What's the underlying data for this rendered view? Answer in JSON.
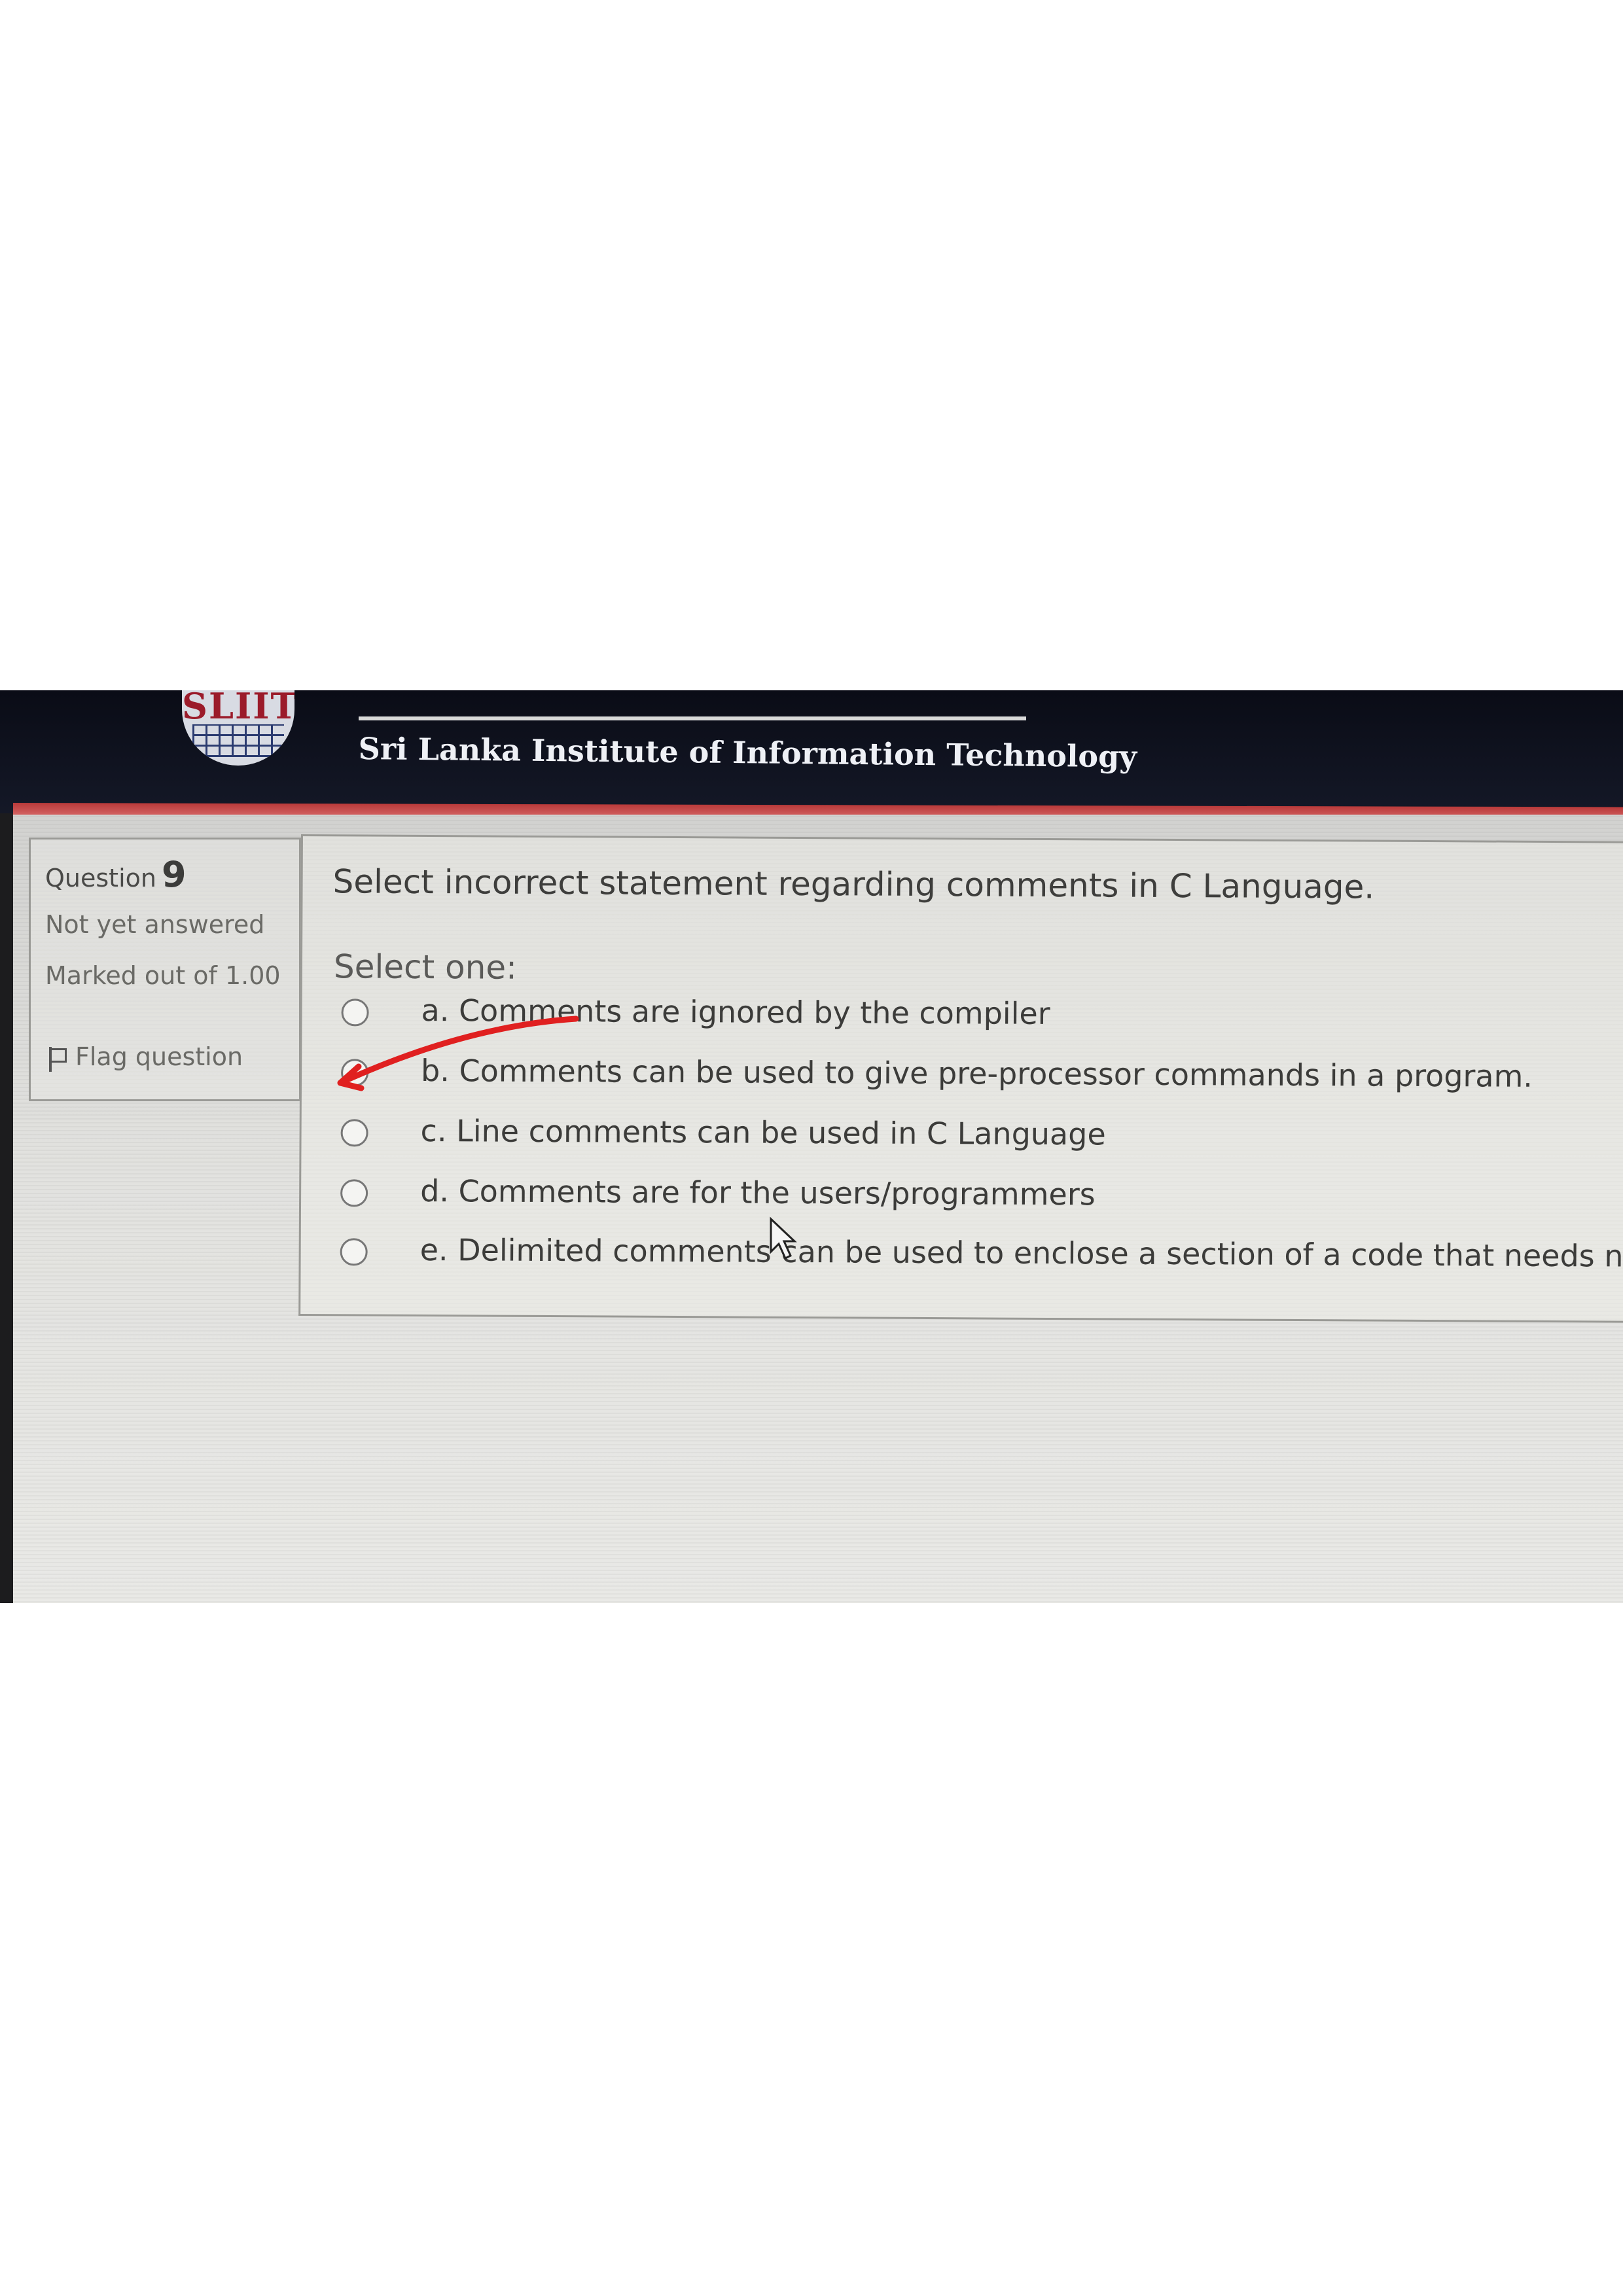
{
  "header": {
    "logo_text": "SLIIT",
    "institute": "Sri Lanka Institute of Information Technology"
  },
  "info": {
    "question_label": "Question",
    "question_number": "9",
    "state": "Not yet answered",
    "marked": "Marked out of 1.00",
    "flag_label": "Flag question"
  },
  "question": {
    "text": "Select incorrect statement regarding comments in C Language.",
    "select_label": "Select one:",
    "options": [
      {
        "label": "a. Comments are ignored by the compiler"
      },
      {
        "label": "b. Comments can be used to give pre-processor commands in a program."
      },
      {
        "label": "c. Line comments can be used in C Language"
      },
      {
        "label": "d. Comments are for the users/programmers"
      },
      {
        "label": "e. Delimited comments can be used to enclose a section of a code that needs not compiled"
      }
    ]
  },
  "annotation": {
    "color": "#e02020"
  }
}
